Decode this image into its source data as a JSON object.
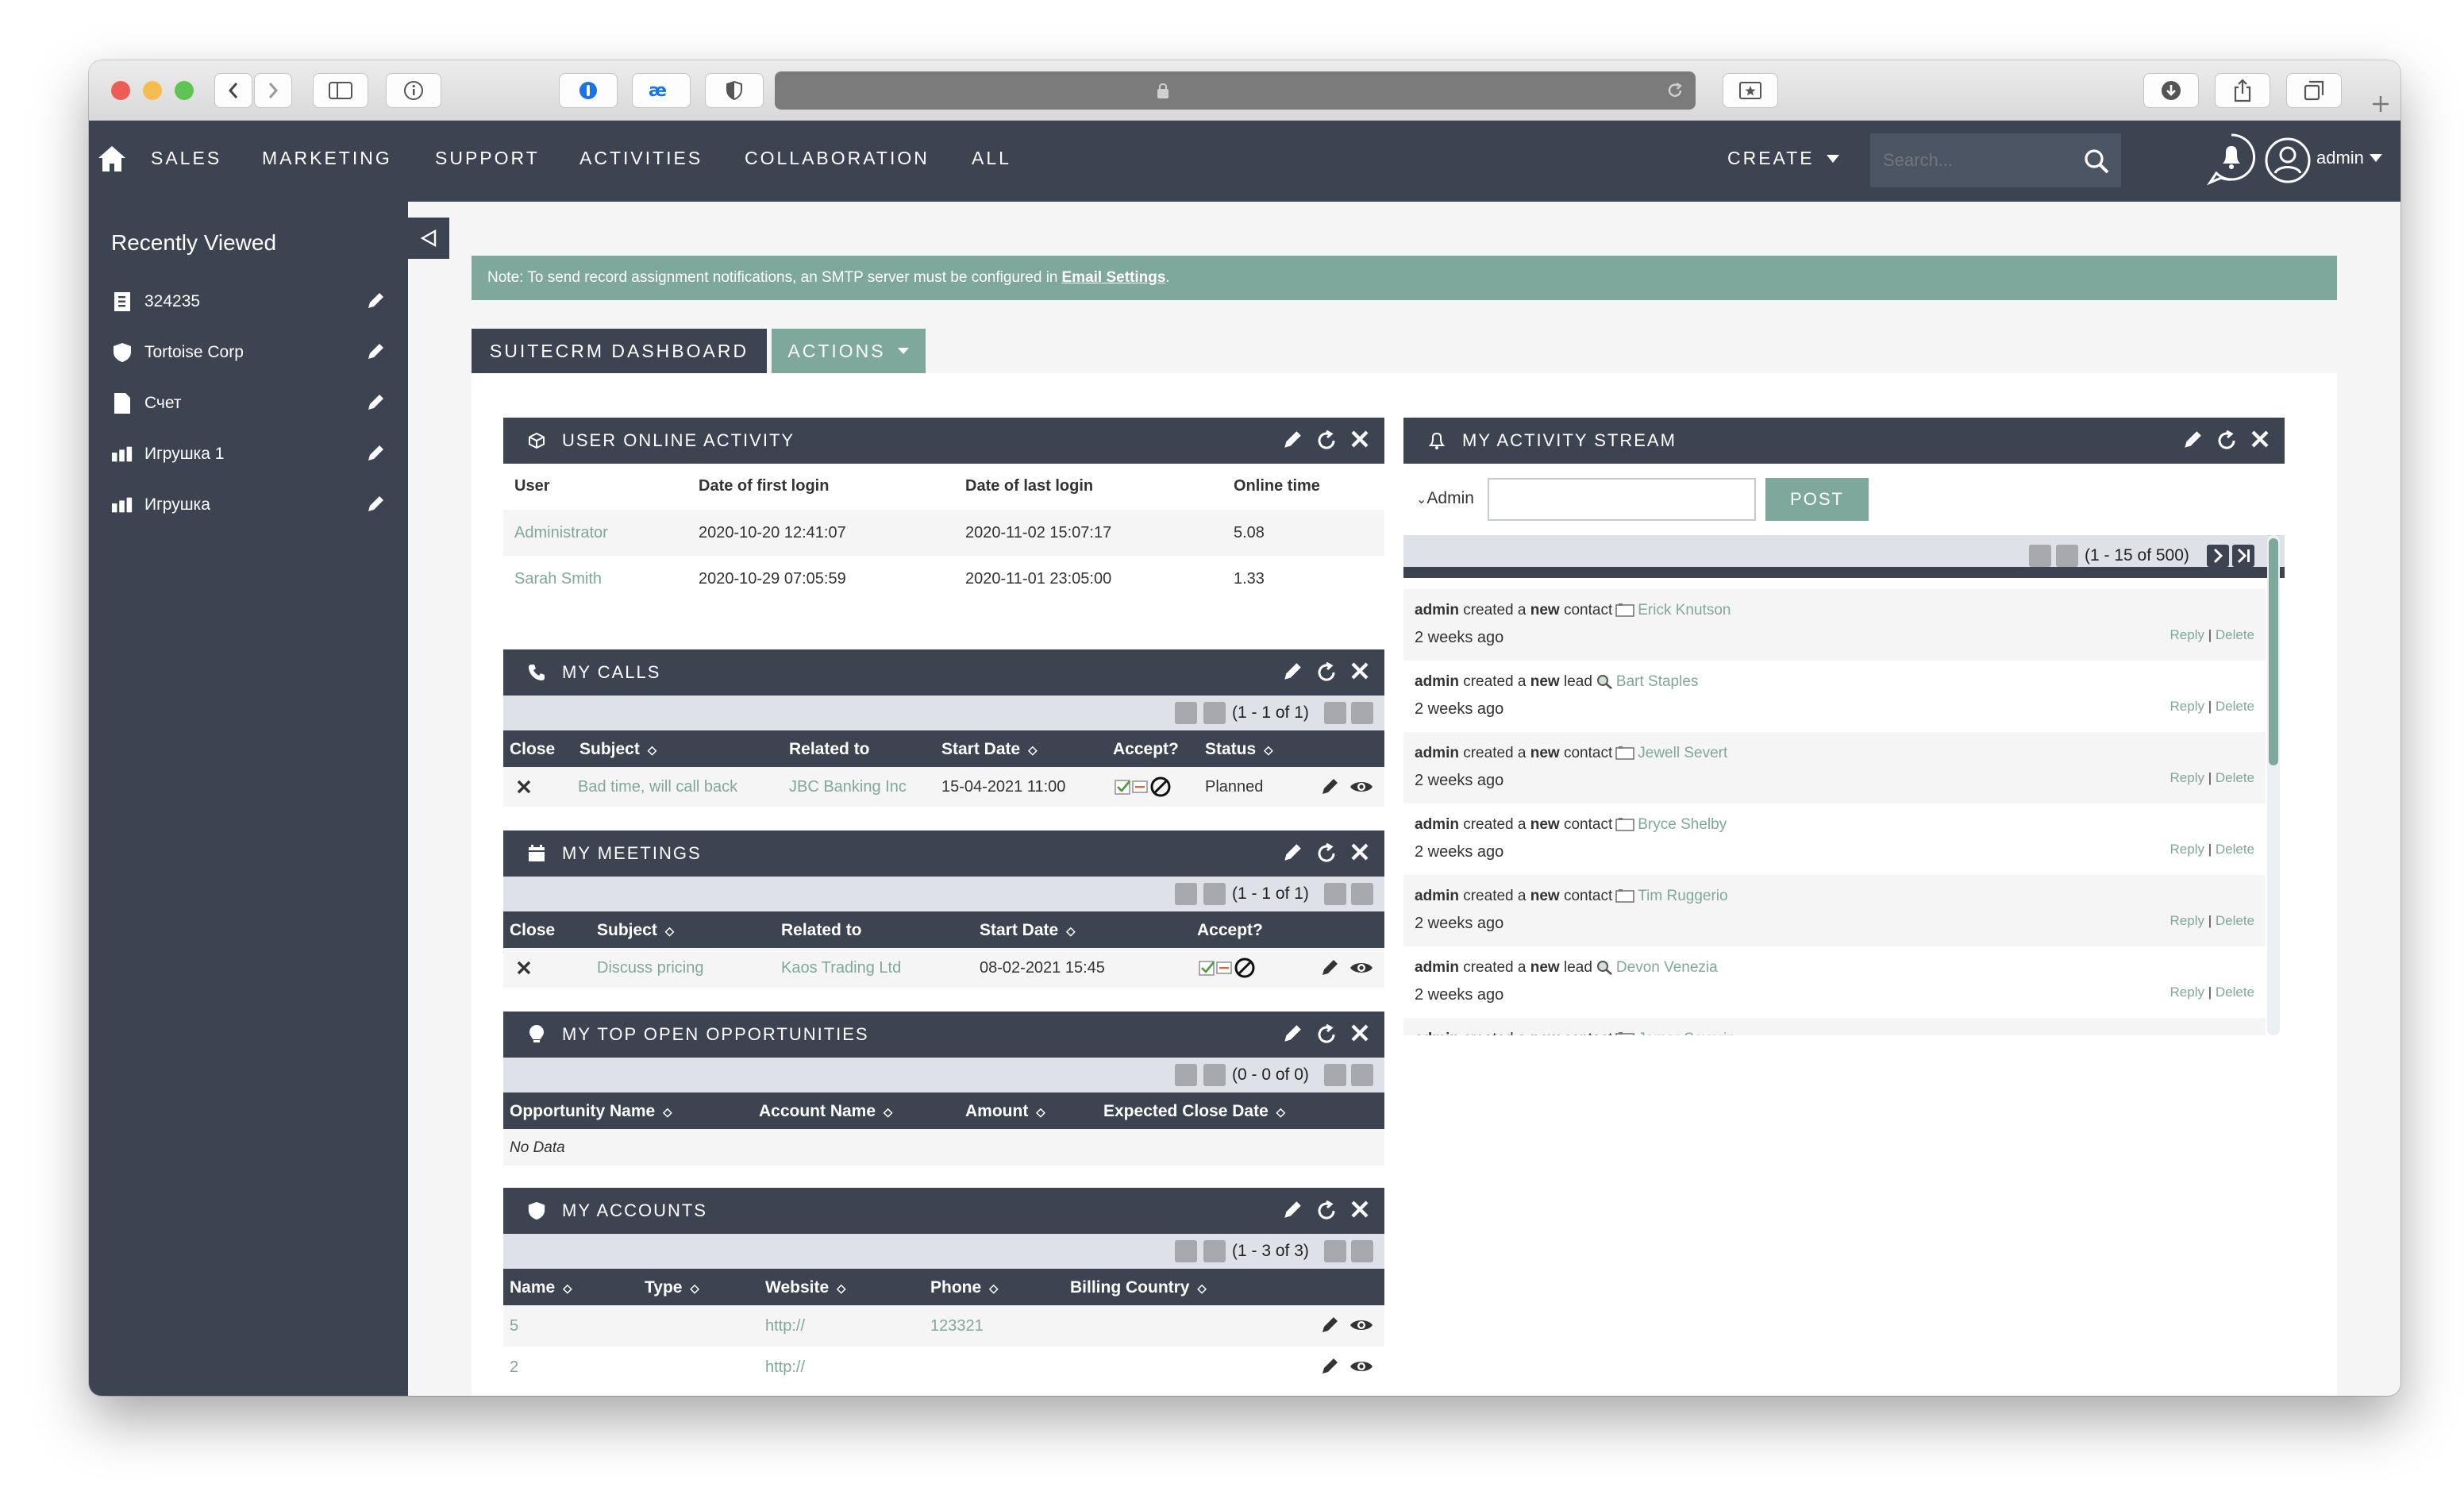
{
  "browser": {
    "address": ""
  },
  "nav": {
    "items": [
      "SALES",
      "MARKETING",
      "SUPPORT",
      "ACTIVITIES",
      "COLLABORATION",
      "ALL"
    ],
    "create": "CREATE",
    "search_placeholder": "Search...",
    "user": "admin"
  },
  "sidebar": {
    "title": "Recently Viewed",
    "items": [
      {
        "label": "324235",
        "icon": "document-icon"
      },
      {
        "label": "Tortoise Corp",
        "icon": "shield-icon"
      },
      {
        "label": "Счет",
        "icon": "file-icon"
      },
      {
        "label": "Игрушка 1",
        "icon": "bars-icon"
      },
      {
        "label": "Игрушка",
        "icon": "bars-icon"
      }
    ]
  },
  "note": {
    "text": "Note: To send record assignment notifications, an SMTP server must be configured in",
    "link": "Email Settings",
    "end": "."
  },
  "tabs": {
    "dashboard": "SUITECRM DASHBOARD",
    "actions": "ACTIONS"
  },
  "online": {
    "title": "USER ONLINE ACTIVITY",
    "headers": [
      "User",
      "Date of first login",
      "Date of last login",
      "Online time"
    ],
    "rows": [
      [
        "Administrator",
        "2020-10-20 12:41:07",
        "2020-11-02 15:07:17",
        "5.08"
      ],
      [
        "Sarah Smith",
        "2020-10-29 07:05:59",
        "2020-11-01 23:05:00",
        "1.33"
      ]
    ]
  },
  "calls": {
    "title": "MY CALLS",
    "pagination": "(1 - 1 of 1)",
    "headers": [
      "Close",
      "Subject",
      "Related to",
      "Start Date",
      "Accept?",
      "Status"
    ],
    "rows": [
      [
        "Bad time, will call back",
        "JBC Banking Inc",
        "15-04-2021 11:00",
        "Planned"
      ]
    ]
  },
  "meetings": {
    "title": "MY MEETINGS",
    "pagination": "(1 - 1 of 1)",
    "headers": [
      "Close",
      "Subject",
      "Related to",
      "Start Date",
      "Accept?"
    ],
    "rows": [
      [
        "Discuss pricing",
        "Kaos Trading Ltd",
        "08-02-2021 15:45"
      ]
    ]
  },
  "opps": {
    "title": "MY TOP OPEN OPPORTUNITIES",
    "pagination": "(0 - 0 of 0)",
    "headers": [
      "Opportunity Name",
      "Account Name",
      "Amount",
      "Expected Close Date"
    ],
    "empty": "No Data"
  },
  "accounts": {
    "title": "MY ACCOUNTS",
    "pagination": "(1 - 3 of 3)",
    "headers": [
      "Name",
      "Type",
      "Website",
      "Phone",
      "Billing Country"
    ],
    "rows": [
      [
        "5",
        "http://",
        "123321"
      ],
      [
        "2",
        "http://",
        ""
      ]
    ]
  },
  "stream": {
    "title": "MY ACTIVITY STREAM",
    "user": "Admin",
    "post": "POST",
    "pagination": "(1 - 15 of 500)",
    "reply": "Reply",
    "delete": "Delete",
    "items": [
      {
        "actor": "admin",
        "verb": "created a",
        "new": "new",
        "type": "contact",
        "target": "Erick Knutson",
        "time": "2 weeks ago"
      },
      {
        "actor": "admin",
        "verb": "created a",
        "new": "new",
        "type": "lead",
        "target": "Bart Staples",
        "time": "2 weeks ago"
      },
      {
        "actor": "admin",
        "verb": "created a",
        "new": "new",
        "type": "contact",
        "target": "Jewell Severt",
        "time": "2 weeks ago"
      },
      {
        "actor": "admin",
        "verb": "created a",
        "new": "new",
        "type": "contact",
        "target": "Bryce Shelby",
        "time": "2 weeks ago"
      },
      {
        "actor": "admin",
        "verb": "created a",
        "new": "new",
        "type": "contact",
        "target": "Tim Ruggerio",
        "time": "2 weeks ago"
      },
      {
        "actor": "admin",
        "verb": "created a",
        "new": "new",
        "type": "lead",
        "target": "Devon Venezia",
        "time": "2 weeks ago"
      },
      {
        "actor": "admin",
        "verb": "created a",
        "new": "new",
        "type": "contact",
        "target": "Jamar Severin",
        "time": ""
      }
    ]
  }
}
